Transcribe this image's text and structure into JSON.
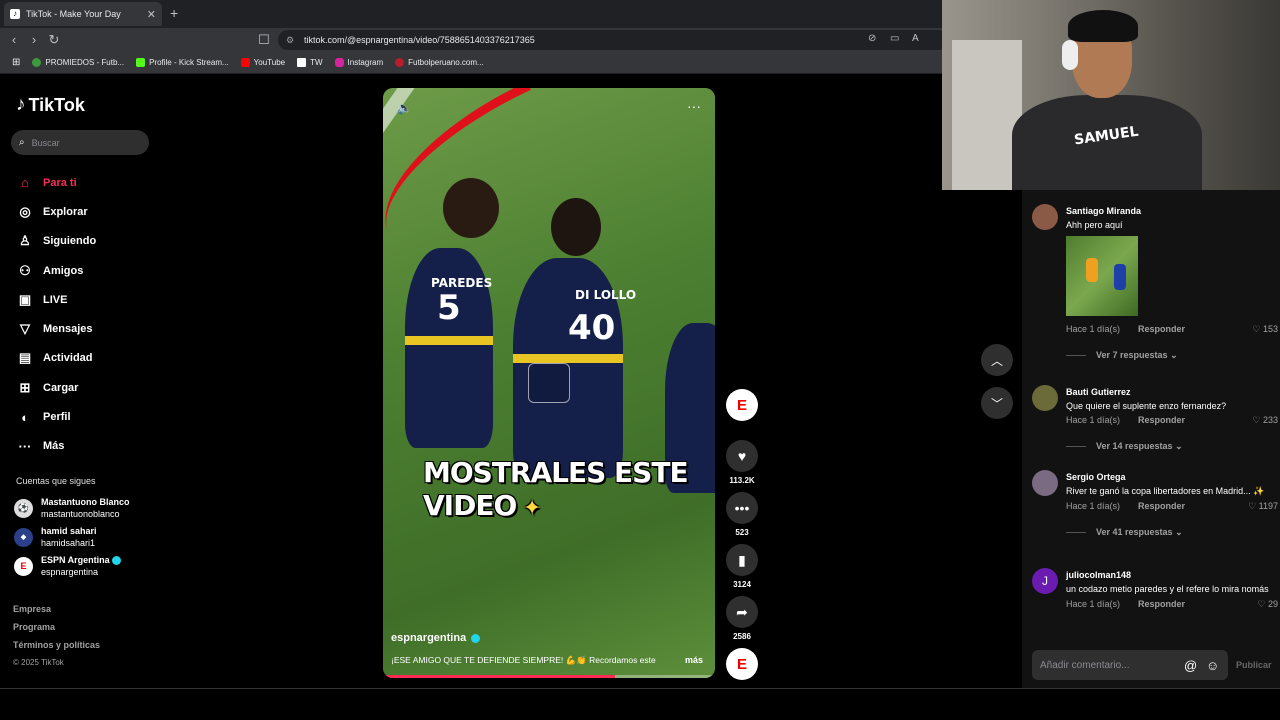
{
  "browser": {
    "tab_title": "TikTok - Make Your Day",
    "url": "tiktok.com/@espnargentina/video/7588651403376217365",
    "bookmarks": [
      "PROMIEDOS - Futb...",
      "Profile - Kick Stream...",
      "YouTube",
      "TW",
      "Instagram",
      "Futbolperuano.com..."
    ]
  },
  "sidebar": {
    "logo": "TikTok",
    "search_placeholder": "Buscar",
    "nav": [
      {
        "label": "Para ti",
        "icon": "home-icon"
      },
      {
        "label": "Explorar",
        "icon": "compass-icon"
      },
      {
        "label": "Siguiendo",
        "icon": "user-follow-icon"
      },
      {
        "label": "Amigos",
        "icon": "friends-icon"
      },
      {
        "label": "LIVE",
        "icon": "live-icon"
      },
      {
        "label": "Mensajes",
        "icon": "messages-icon"
      },
      {
        "label": "Actividad",
        "icon": "activity-icon"
      },
      {
        "label": "Cargar",
        "icon": "upload-icon"
      },
      {
        "label": "Perfil",
        "icon": "profile-icon"
      },
      {
        "label": "Más",
        "icon": "more-icon"
      }
    ],
    "following_title": "Cuentas que sigues",
    "following": [
      {
        "name": "Mastantuono Blanco",
        "handle": "mastantuonoblanco"
      },
      {
        "name": "hamid sahari",
        "handle": "hamidsahari1"
      },
      {
        "name": "ESPN Argentina",
        "handle": "espnargentina"
      }
    ],
    "footer": [
      "Empresa",
      "Programa",
      "Términos y políticas",
      "© 2025 TikTok"
    ]
  },
  "video": {
    "overlay_text": "MOSTRALES ESTE VIDEO",
    "jersey_left": "PAREDES",
    "jersey_left_num": "5",
    "jersey_right": "DI LOLLO",
    "jersey_right_num": "40",
    "author": "espnargentina",
    "caption": "¡ESE AMIGO QUE TE DEFIENDE SIEMPRE! 💪👏 Recordamos este",
    "more": "más",
    "progress": 0.7
  },
  "actions": {
    "likes": "113.2K",
    "comments": "523",
    "saves": "3124",
    "shares": "2586"
  },
  "comments": [
    {
      "user": "Santiago Miranda",
      "text": "Ahh pero aquí",
      "time": "Hace 1 día(s)",
      "reply": "Responder",
      "likes": "153",
      "thread": "Ver 7 respuestas"
    },
    {
      "user": "Bauti Gutierrez",
      "text": "Que quiere el suplente enzo fernandez?",
      "time": "Hace 1 día(s)",
      "reply": "Responder",
      "likes": "233",
      "thread": "Ver 14 respuestas"
    },
    {
      "user": "Sergio Ortega",
      "text": "River te ganó la copa libertadores en Madrid... ✨",
      "time": "Hace 1 día(s)",
      "reply": "Responder",
      "likes": "1197",
      "thread": "Ver 41 respuestas"
    },
    {
      "user": "juliocolman148",
      "text": "un codazo metio paredes y el refere lo mira nomás",
      "time": "Hace 1 día(s)",
      "reply": "Responder",
      "likes": "29"
    }
  ],
  "comment_box": {
    "placeholder": "Añadir comentario...",
    "publish": "Publicar"
  },
  "webcam": {
    "shirt_text": "SAMUEL"
  }
}
